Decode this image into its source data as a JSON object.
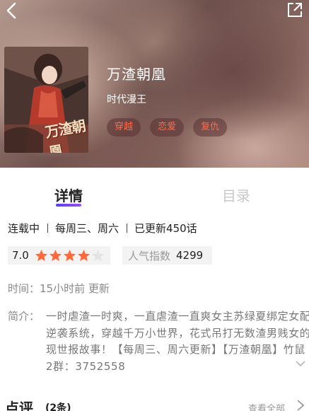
{
  "header": {
    "back_icon": "chevron-left-icon",
    "share_icon": "share-icon"
  },
  "comic": {
    "cover_text": "万渣朝凰",
    "title": "万渣朝凰",
    "author": "时代漫王",
    "tags": [
      "穿越",
      "恋爱",
      "复仇"
    ],
    "tag_color": "#ff6a4a"
  },
  "tabs": {
    "detail": "详情",
    "catalog": "目录",
    "accent": "#6a45f0"
  },
  "status": {
    "serial": "连载中",
    "schedule": "每周三、周六",
    "updated": "已更新450话"
  },
  "rating": {
    "score": "7.0",
    "stars_filled": 4,
    "stars_total": 5,
    "star_color": "#ff6a3d",
    "popularity_label": "人气指数",
    "popularity_value": "4299"
  },
  "time": {
    "label": "时间：",
    "value": "15小时前 更新"
  },
  "intro": {
    "label": "简介：",
    "text": "一时虐渣一时爽，一直虐渣一直爽女主苏绿夏绑定女配逆袭系统，穿越千万小世界，花式吊打无数渣男贱女的现世报故事！【每周三、周六更新】【万渣朝凰】竹鼠2群：3752558"
  },
  "reviews": {
    "title": "点评",
    "count": "(2条)",
    "view_all": "查看全部"
  }
}
